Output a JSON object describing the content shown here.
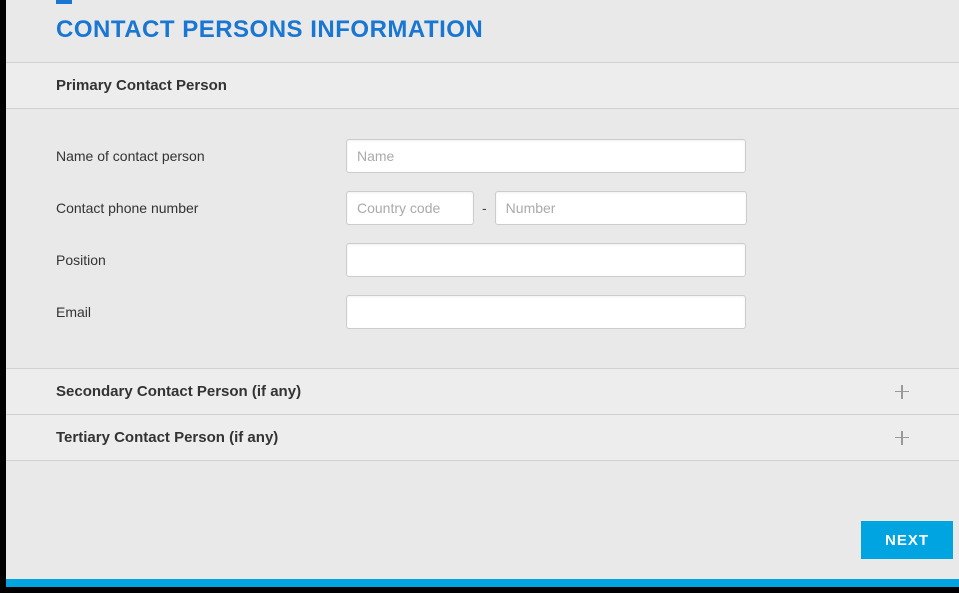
{
  "header": {
    "title": "CONTACT PERSONS INFORMATION"
  },
  "sections": {
    "primary": {
      "title": "Primary Contact Person",
      "fields": {
        "name_label": "Name of contact person",
        "name_placeholder": "Name",
        "phone_label": "Contact phone number",
        "phone_code_placeholder": "Country code",
        "phone_dash": "-",
        "phone_number_placeholder": "Number",
        "position_label": "Position",
        "email_label": "Email"
      }
    },
    "secondary": {
      "title": "Secondary Contact Person",
      "hint": "(if any)"
    },
    "tertiary": {
      "title": "Tertiary Contact Person",
      "hint": "(if any)"
    }
  },
  "actions": {
    "next_label": "NEXT"
  }
}
